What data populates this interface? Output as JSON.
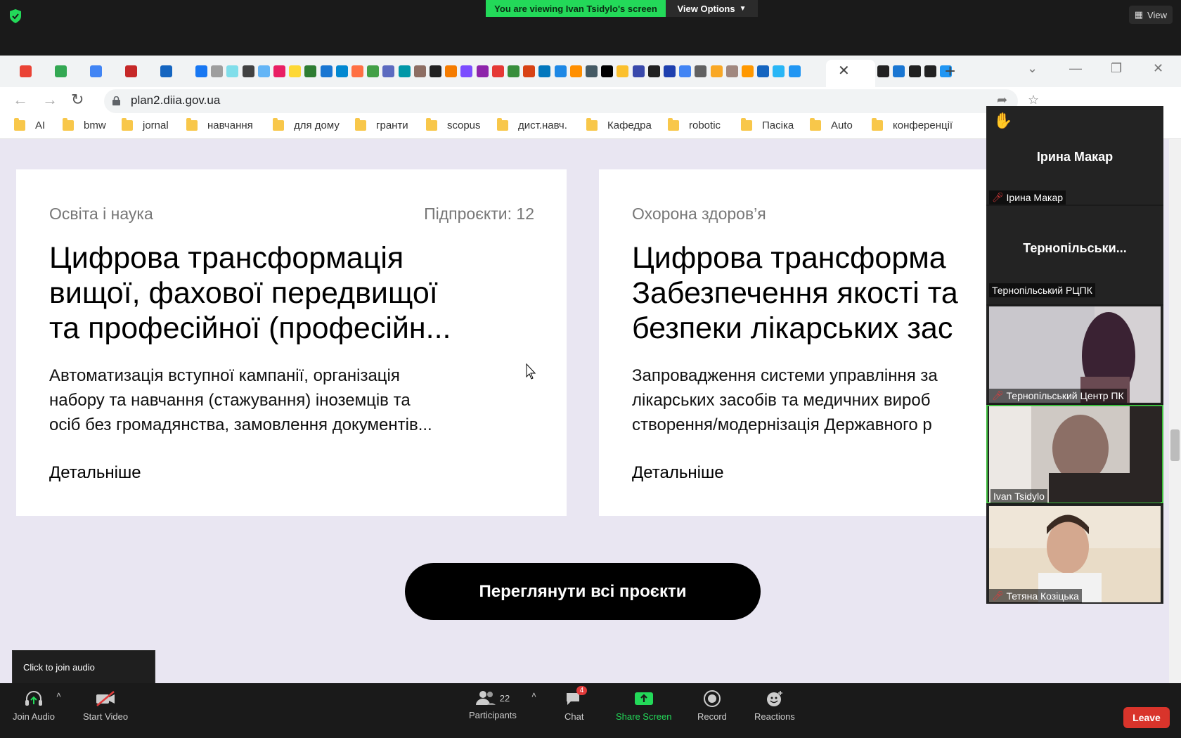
{
  "zoom_top": {
    "viewing_banner": "You are viewing Ivan Tsidylo's screen",
    "view_options": "View Options",
    "view_button": "View"
  },
  "browser": {
    "url": "plan2.diia.gov.ua",
    "bookmarks": [
      "AI",
      "bmw",
      "jornal",
      "навчання",
      "для дому",
      "гранти",
      "scopus",
      "дист.навч.",
      "Кафедра",
      "robotic",
      "Пасіка",
      "Auto",
      "конференції"
    ]
  },
  "page": {
    "card1": {
      "category": "Освіта і наука",
      "subprojects": "Підпроєкти: 12",
      "title": "Цифрова трансформація\nвищої, фахової передвищої\nта професійної (професійн...",
      "description": "Автоматизація вступної кампанії, організація\nнабору та навчання (стажування) іноземців та\nосіб без громадянства, замовлення документів...",
      "more": "Детальніше"
    },
    "card2": {
      "category": "Охорона здоров’я",
      "title": "Цифрова трансформа\nЗабезпечення якості та\nбезпеки лікарських зас",
      "description": "Запровадження системи управління за\nлікарських засобів та медичних вироб\nстворення/модернізація Державного р",
      "more": "Детальніше"
    },
    "all_projects_button": "Переглянути всі проєкти"
  },
  "video_panel": {
    "tile1_big": "Ірина Макар",
    "tile1_label": "Ірина Макар",
    "tile2_big": "Тернопільськи...",
    "tile2_label": "Тернопільський РЦПК",
    "tile3_label": "Тернопільський Центр ПК",
    "tile4_label": "Ivan Tsidylo",
    "tile5_label": "Тетяна Козіцька",
    "raised_hand": "✋"
  },
  "zoom_bottom": {
    "join_audio": "Join Audio",
    "start_video": "Start Video",
    "participants": "Participants",
    "participants_count": "22",
    "chat": "Chat",
    "chat_badge": "4",
    "share_screen": "Share Screen",
    "record": "Record",
    "reactions": "Reactions",
    "leave": "Leave",
    "tooltip": "Click to join audio"
  }
}
